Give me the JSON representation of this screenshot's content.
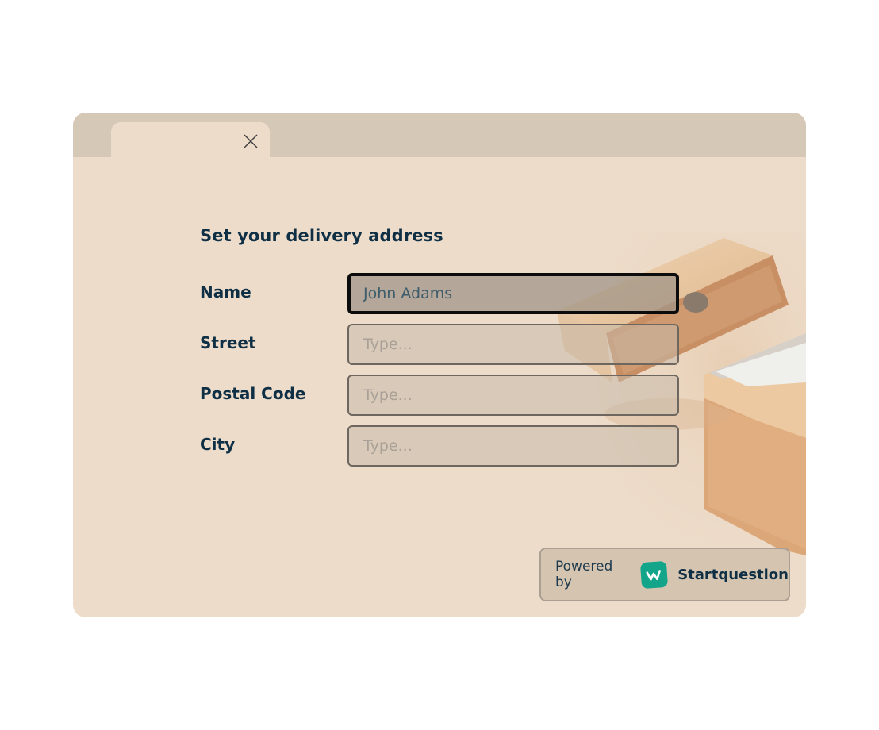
{
  "window": {
    "tab_close_icon": "close-icon"
  },
  "form": {
    "title": "Set your delivery address",
    "fields": [
      {
        "label": "Name",
        "value": "John Adams",
        "placeholder": "Type...",
        "focused": true
      },
      {
        "label": "Street",
        "value": "",
        "placeholder": "Type...",
        "focused": false
      },
      {
        "label": "Postal Code",
        "value": "",
        "placeholder": "Type...",
        "focused": false
      },
      {
        "label": "City",
        "value": "",
        "placeholder": "Type...",
        "focused": false
      }
    ]
  },
  "footer": {
    "powered_by": "Powered by",
    "brand_name": "Startquestion",
    "brand_icon": "startquestion-logo-icon",
    "brand_color": "#13a58a"
  },
  "colors": {
    "card_background": "#eddcca",
    "tabstrip_background": "#d6c8b6",
    "text_primary": "#0f2f45"
  }
}
